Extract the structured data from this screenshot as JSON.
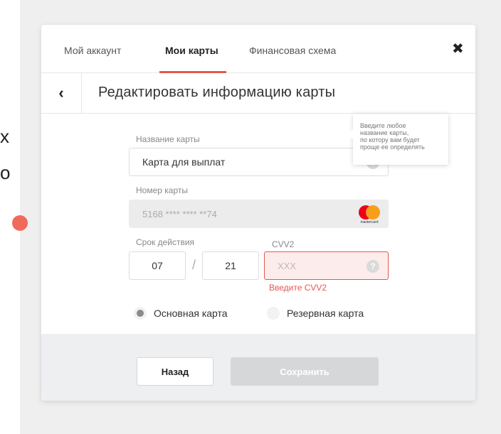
{
  "background": {
    "text_line_1": "х",
    "text_line_2": "о"
  },
  "tabs": [
    {
      "label": "Мой аккаунт"
    },
    {
      "label": "Мои карты"
    },
    {
      "label": "Финансовая схема"
    }
  ],
  "active_tab": "Мои карты",
  "close_icon": "✖",
  "back_icon": "‹",
  "subtitle": "Редактировать информацию карты",
  "card_name": {
    "label": "Название карты",
    "value": "Карта для выплат",
    "help_icon": "?",
    "tooltip_lines": [
      "Введите любое",
      "название карты,",
      "по котору вам будет",
      "проще ее определять"
    ]
  },
  "card_number": {
    "label": "Номер карты",
    "value": "5168  **** **** **74",
    "brand": "mastercard"
  },
  "expiry": {
    "label": "Срок действия",
    "month": "07",
    "separator": "/",
    "year": "21"
  },
  "cvv": {
    "label": "CVV2",
    "placeholder": "XXX",
    "help_icon": "?",
    "error": "Введите CVV2"
  },
  "card_type": {
    "options": [
      "Основная карта",
      "Резервная карта"
    ],
    "selected": "Основная карта"
  },
  "buttons": {
    "back": "Назад",
    "save": "Сохранить"
  },
  "colors": {
    "accent": "#e5574f",
    "error_bg": "#fdecec",
    "disabled_button": "#d6d7d9"
  }
}
